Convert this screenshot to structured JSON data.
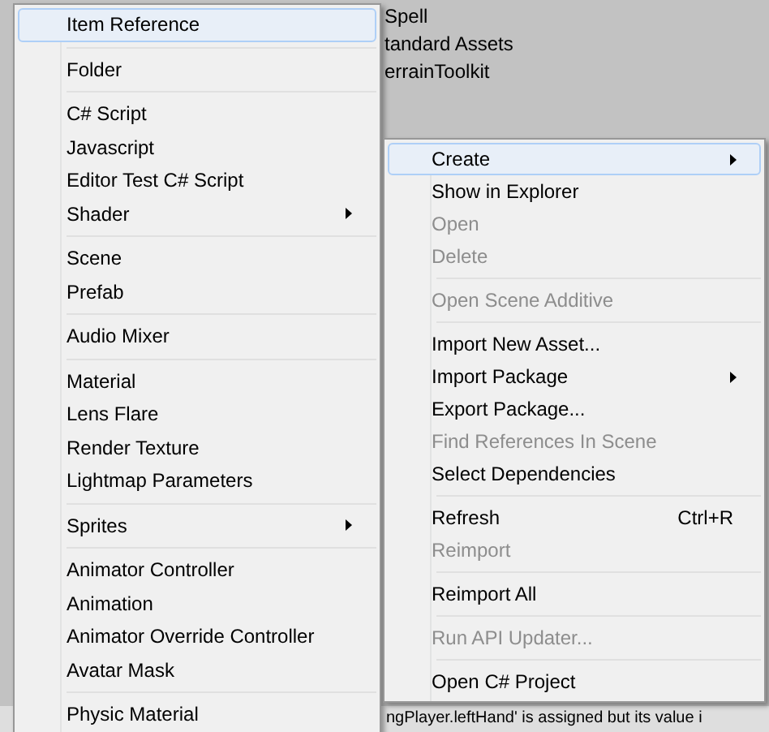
{
  "project_items": [
    "Spell",
    "tandard Assets",
    "errainToolkit"
  ],
  "console_line": "ngPlayer.leftHand' is assigned but its value i",
  "create_menu": {
    "groups": [
      [
        {
          "label": "Item Reference",
          "selected": true,
          "submenu": false
        }
      ],
      [
        {
          "label": "Folder",
          "selected": false,
          "submenu": false
        }
      ],
      [
        {
          "label": "C# Script",
          "selected": false,
          "submenu": false
        },
        {
          "label": "Javascript",
          "selected": false,
          "submenu": false
        },
        {
          "label": "Editor Test C# Script",
          "selected": false,
          "submenu": false
        },
        {
          "label": "Shader",
          "selected": false,
          "submenu": true
        }
      ],
      [
        {
          "label": "Scene",
          "selected": false,
          "submenu": false
        },
        {
          "label": "Prefab",
          "selected": false,
          "submenu": false
        }
      ],
      [
        {
          "label": "Audio Mixer",
          "selected": false,
          "submenu": false
        }
      ],
      [
        {
          "label": "Material",
          "selected": false,
          "submenu": false
        },
        {
          "label": "Lens Flare",
          "selected": false,
          "submenu": false
        },
        {
          "label": "Render Texture",
          "selected": false,
          "submenu": false
        },
        {
          "label": "Lightmap Parameters",
          "selected": false,
          "submenu": false
        }
      ],
      [
        {
          "label": "Sprites",
          "selected": false,
          "submenu": true
        }
      ],
      [
        {
          "label": "Animator Controller",
          "selected": false,
          "submenu": false
        },
        {
          "label": "Animation",
          "selected": false,
          "submenu": false
        },
        {
          "label": "Animator Override Controller",
          "selected": false,
          "submenu": false
        },
        {
          "label": "Avatar Mask",
          "selected": false,
          "submenu": false
        }
      ],
      [
        {
          "label": "Physic Material",
          "selected": false,
          "submenu": false
        }
      ]
    ]
  },
  "context_menu": {
    "groups": [
      [
        {
          "label": "Create",
          "selected": true,
          "submenu": true,
          "disabled": false
        },
        {
          "label": "Show in Explorer",
          "selected": false,
          "submenu": false,
          "disabled": false
        },
        {
          "label": "Open",
          "selected": false,
          "submenu": false,
          "disabled": true
        },
        {
          "label": "Delete",
          "selected": false,
          "submenu": false,
          "disabled": true
        }
      ],
      [
        {
          "label": "Open Scene Additive",
          "selected": false,
          "submenu": false,
          "disabled": true
        }
      ],
      [
        {
          "label": "Import New Asset...",
          "selected": false,
          "submenu": false,
          "disabled": false
        },
        {
          "label": "Import Package",
          "selected": false,
          "submenu": true,
          "disabled": false
        },
        {
          "label": "Export Package...",
          "selected": false,
          "submenu": false,
          "disabled": false
        },
        {
          "label": "Find References In Scene",
          "selected": false,
          "submenu": false,
          "disabled": true
        },
        {
          "label": "Select Dependencies",
          "selected": false,
          "submenu": false,
          "disabled": false
        }
      ],
      [
        {
          "label": "Refresh",
          "selected": false,
          "submenu": false,
          "disabled": false,
          "shortcut": "Ctrl+R"
        },
        {
          "label": "Reimport",
          "selected": false,
          "submenu": false,
          "disabled": true
        }
      ],
      [
        {
          "label": "Reimport All",
          "selected": false,
          "submenu": false,
          "disabled": false
        }
      ],
      [
        {
          "label": "Run API Updater...",
          "selected": false,
          "submenu": false,
          "disabled": true
        }
      ],
      [
        {
          "label": "Open C# Project",
          "selected": false,
          "submenu": false,
          "disabled": false
        }
      ]
    ]
  }
}
